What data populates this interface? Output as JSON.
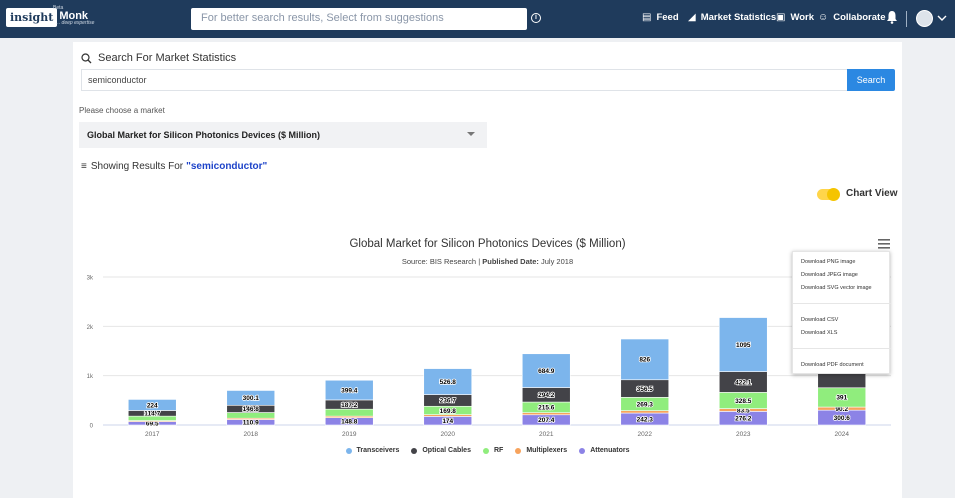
{
  "topbar": {
    "logo_box": "insight",
    "logo_text": "Monk",
    "logo_beta": "Beta",
    "logo_tagline": "... deep expertise",
    "search_placeholder": "For better search results, Select from suggestions",
    "nav": {
      "feed": "Feed",
      "market_statistics": "Market Statistics",
      "work": "Work",
      "collaborate": "Collaborate"
    }
  },
  "search_panel": {
    "title": "Search For Market Statistics",
    "query": "semiconductor",
    "button": "Search"
  },
  "market": {
    "label": "Please choose a market",
    "selected": "Global Market for Silicon Photonics Devices ($ Million)"
  },
  "results": {
    "prefix": "Showing Results For",
    "query_quoted": "\"semiconductor\""
  },
  "view_toggle": {
    "label": "Chart View",
    "on": true
  },
  "chart_data": {
    "type": "bar",
    "stacked": true,
    "title": "Global Market for Silicon Photonics Devices ($ Million)",
    "source_label": "Source:",
    "source": "BIS Research",
    "published_label": "Published Date:",
    "published": "July 2018",
    "categories": [
      "2017",
      "2018",
      "2019",
      "2020",
      "2021",
      "2022",
      "2023",
      "2024"
    ],
    "y_ticks": [
      "0",
      "1k",
      "2k",
      "3k"
    ],
    "ylim": [
      0,
      3000
    ],
    "series": [
      {
        "name": "Attenuators",
        "color": "#8c83e6",
        "values": [
          69.5,
          110.9,
          148.8,
          174,
          207.4,
          242.3,
          276.2,
          300.6
        ],
        "labels": [
          "69.5",
          "110.9",
          "148.8",
          "174",
          "207.4",
          "242.3",
          "276.2",
          "300.6"
        ]
      },
      {
        "name": "Multiplexers",
        "color": "#f7a35c",
        "values": [
          20,
          27,
          31,
          36,
          42,
          49,
          56,
          63
        ],
        "labels": [
          "",
          "",
          "",
          "",
          "",
          "",
          "83.5",
          "90.2"
        ]
      },
      {
        "name": "RF",
        "color": "#90ed7d",
        "values": [
          90,
          115,
          141,
          169.8,
          215.6,
          269.3,
          328.5,
          391
        ],
        "labels": [
          "",
          "",
          "",
          "169.8",
          "215.6",
          "269.3",
          "328.5",
          "391"
        ]
      },
      {
        "name": "Optical Cables",
        "color": "#434348",
        "values": [
          114.7,
          146.8,
          187.2,
          236.7,
          294.2,
          356.5,
          422.1,
          500
        ],
        "labels": [
          "114.7",
          "146.8",
          "187.2",
          "236.7",
          "294.2",
          "356.5",
          "422.1",
          ""
        ]
      },
      {
        "name": "Transceivers",
        "color": "#7cb5ec",
        "values": [
          224,
          300.1,
          399.4,
          526.8,
          684.9,
          826,
          1095,
          1200
        ],
        "labels": [
          "224",
          "300.1",
          "399.4",
          "526.8",
          "684.9",
          "826",
          "1095",
          ""
        ]
      }
    ],
    "legend_order": [
      "Transceivers",
      "Optical Cables",
      "RF",
      "Multiplexers",
      "Attenuators"
    ],
    "legend_placement": "bottom-center",
    "grid": true
  },
  "export_menu": {
    "png": "Download PNG image",
    "jpeg": "Download JPEG image",
    "svg": "Download SVG vector image",
    "csv": "Download CSV",
    "xls": "Download XLS",
    "pdf": "Download PDF document"
  }
}
